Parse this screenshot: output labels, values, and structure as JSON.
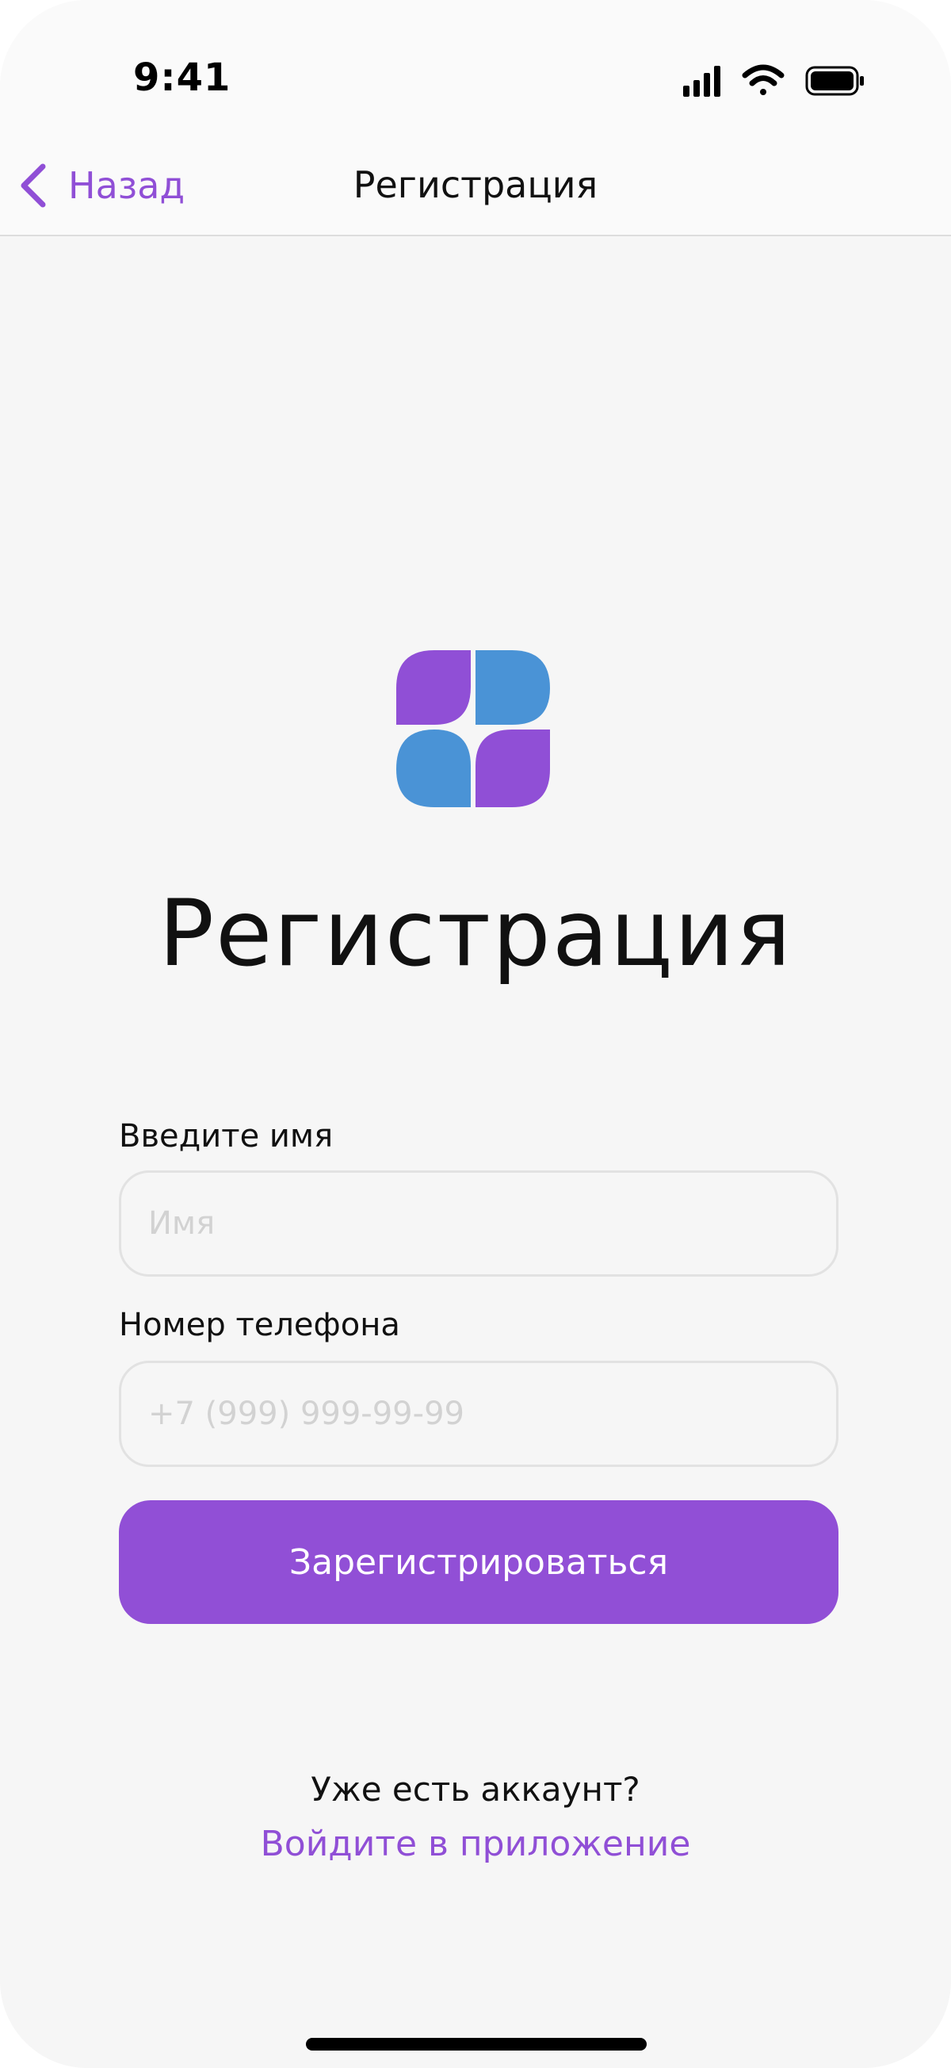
{
  "status_bar": {
    "time": "9:41",
    "icons": [
      "cellular-signal-icon",
      "wifi-icon",
      "battery-icon"
    ]
  },
  "nav": {
    "back_icon": "chevron-left-icon",
    "back_label": "Назад",
    "title": "Регистрация"
  },
  "logo": {
    "icon": "app-logo-icon",
    "colors": {
      "purple": "#904fd6",
      "blue": "#4a93d6"
    }
  },
  "main": {
    "heading": "Регистрация",
    "name_field": {
      "label": "Введите имя",
      "value": "",
      "placeholder": "Имя"
    },
    "phone_field": {
      "label": "Номер телефона",
      "value": "",
      "placeholder": "+7 (999) 999-99-99"
    },
    "submit_label": "Зарегистрироваться"
  },
  "footer": {
    "have_account": "Уже есть аккаунт?",
    "login_link": "Войдите в приложение"
  },
  "colors": {
    "accent": "#904fd6",
    "background": "#f6f6f6",
    "field_border": "#e2e2e2",
    "placeholder": "#d2d2d2"
  }
}
